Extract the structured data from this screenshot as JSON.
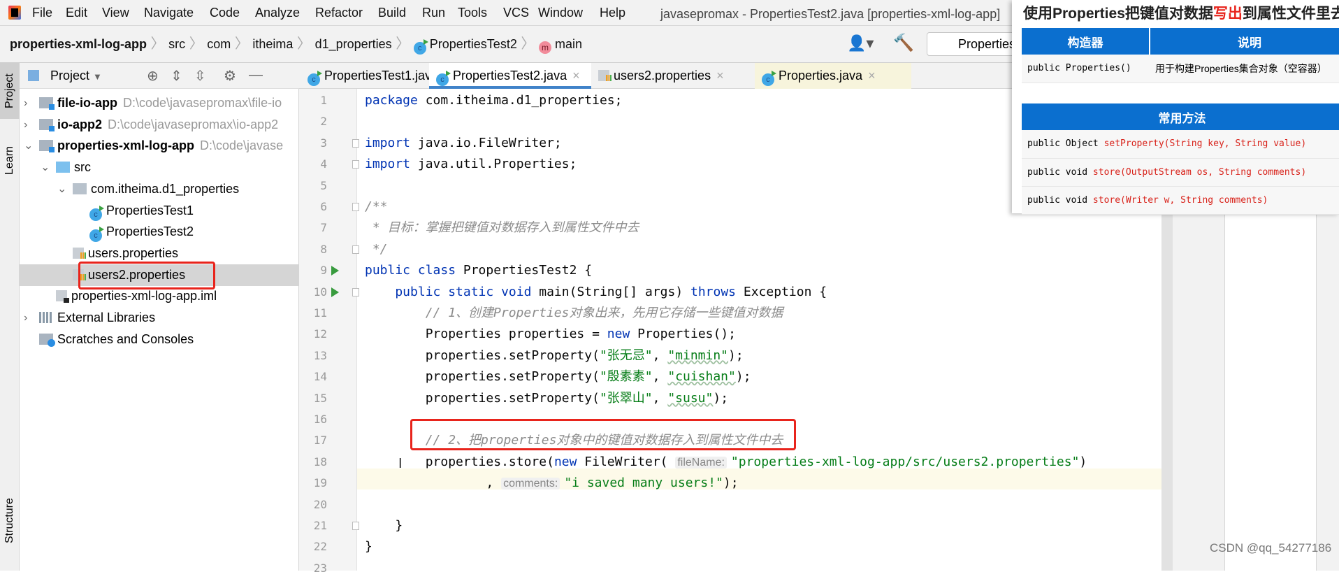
{
  "menu": [
    "File",
    "Edit",
    "View",
    "Navigate",
    "Code",
    "Analyze",
    "Refactor",
    "Build",
    "Run",
    "Tools",
    "VCS",
    "Window",
    "Help"
  ],
  "window_title": "javasepromax - PropertiesTest2.java [properties-xml-log-app]",
  "breadcrumb": [
    "properties-xml-log-app",
    "src",
    "com",
    "itheima",
    "d1_properties",
    "PropertiesTest2",
    "main"
  ],
  "run_config": "Properties",
  "left_stripe": {
    "project": "Project",
    "learn": "Learn",
    "structure": "Structure"
  },
  "project_panel": {
    "title": "Project",
    "tree": [
      {
        "label": "file-io-app",
        "path": "D:\\code\\javasepromax\\file-io",
        "icon": "module",
        "depth": 0,
        "arrow": "›",
        "bold": true
      },
      {
        "label": "io-app2",
        "path": "D:\\code\\javasepromax\\io-app2",
        "icon": "module",
        "depth": 0,
        "arrow": "›",
        "bold": true
      },
      {
        "label": "properties-xml-log-app",
        "path": "D:\\code\\javase",
        "icon": "module",
        "depth": 0,
        "arrow": "⌄",
        "bold": true
      },
      {
        "label": "src",
        "icon": "folder",
        "depth": 1,
        "arrow": "⌄"
      },
      {
        "label": "com.itheima.d1_properties",
        "icon": "package",
        "depth": 2,
        "arrow": "⌄"
      },
      {
        "label": "PropertiesTest1",
        "icon": "class",
        "depth": 3
      },
      {
        "label": "PropertiesTest2",
        "icon": "class",
        "depth": 3
      },
      {
        "label": "users.properties",
        "icon": "properties",
        "depth": 2
      },
      {
        "label": "users2.properties",
        "icon": "properties",
        "depth": 2,
        "selected": true
      },
      {
        "label": "properties-xml-log-app.iml",
        "icon": "iml",
        "depth": 1
      },
      {
        "label": "External Libraries",
        "icon": "library",
        "depth": 0,
        "arrow": "›"
      },
      {
        "label": "Scratches and Consoles",
        "icon": "scratch",
        "depth": 0
      }
    ]
  },
  "tabs": [
    {
      "label": "PropertiesTest1.java",
      "icon": "class"
    },
    {
      "label": "PropertiesTest2.java",
      "icon": "class",
      "active": true
    },
    {
      "label": "users2.properties",
      "icon": "properties"
    },
    {
      "label": "Properties.java",
      "icon": "class-lib",
      "highlighted": true
    }
  ],
  "code": [
    [
      [
        "package",
        "kw"
      ],
      [
        " com.itheima.d1_properties;",
        ""
      ]
    ],
    [],
    [
      [
        "import",
        "kw"
      ],
      [
        " java.io.FileWriter;",
        ""
      ]
    ],
    [
      [
        "import",
        "kw"
      ],
      [
        " java.util.Properties;",
        ""
      ]
    ],
    [],
    [
      [
        "/**",
        "cm"
      ]
    ],
    [
      [
        " * 目标：掌握把键值对数据存入到属性文件中去",
        "cm"
      ]
    ],
    [
      [
        " */",
        "cm"
      ]
    ],
    [
      [
        "public class",
        "kw"
      ],
      [
        " PropertiesTest2 {",
        ""
      ]
    ],
    [
      [
        "    public static void",
        "kw"
      ],
      [
        " main(String[] args) ",
        ""
      ],
      [
        "throws",
        "kw"
      ],
      [
        " Exception {",
        ""
      ]
    ],
    [
      [
        "        // 1、创建Properties对象出来，先用它存储一些键值对数据",
        "cm"
      ]
    ],
    [
      [
        "        Properties properties = ",
        ""
      ],
      [
        "new",
        "kw"
      ],
      [
        " Properties();",
        ""
      ]
    ],
    [
      [
        "        properties.setProperty(",
        ""
      ],
      [
        "\"张无忌\"",
        "str"
      ],
      [
        ", ",
        ""
      ],
      [
        "\"minmin\"",
        "str wavy"
      ],
      [
        ");",
        ""
      ]
    ],
    [
      [
        "        properties.setProperty(",
        ""
      ],
      [
        "\"殷素素\"",
        "str"
      ],
      [
        ", ",
        ""
      ],
      [
        "\"cuishan\"",
        "str wavy"
      ],
      [
        ");",
        ""
      ]
    ],
    [
      [
        "        properties.setProperty(",
        ""
      ],
      [
        "\"张翠山\"",
        "str"
      ],
      [
        ", ",
        ""
      ],
      [
        "\"susu\"",
        "str wavy"
      ],
      [
        ");",
        ""
      ]
    ],
    [],
    [
      [
        "        // 2、把properties对象中的键值对数据存入到属性文件中去",
        "cm"
      ]
    ],
    [
      [
        "        properties.store(",
        ""
      ],
      [
        "new",
        "kw"
      ],
      [
        " FileWriter( ",
        ""
      ],
      [
        "fileName:",
        "hint"
      ],
      [
        "\"properties-xml-log-app/src/users2.properties\"",
        "str"
      ],
      [
        ")",
        ""
      ]
    ],
    [
      [
        "                , ",
        ""
      ],
      [
        "comments:",
        "hint"
      ],
      [
        "\"i saved many users!\"",
        "str"
      ],
      [
        ");",
        ""
      ]
    ],
    [],
    [
      [
        "    }",
        ""
      ]
    ],
    [
      [
        "}",
        ""
      ]
    ],
    []
  ],
  "run_lines": [
    9,
    10
  ],
  "fold_lines": [
    3,
    4,
    6,
    8,
    10,
    21
  ],
  "current_line": 19,
  "reference": {
    "title_pre": "使用Properties把键值对数据",
    "title_hl": "写出",
    "title_post": "到属性文件里去",
    "constructor_table": {
      "headers": [
        "构造器",
        "说明"
      ],
      "rows": [
        [
          "public Properties()",
          "用于构建Properties集合对象（空容器）"
        ]
      ]
    },
    "methods_table": {
      "header": "常用方法",
      "rows": [
        {
          "pre": "public Object ",
          "sig": "setProperty(String key, String value)"
        },
        {
          "pre": "public void ",
          "sig": "store(OutputStream os, String comments)"
        },
        {
          "pre": "public void ",
          "sig": "store(Writer w, String comments)"
        }
      ]
    },
    "highlight_color": "#e8241c",
    "header_color": "#0b6fcf"
  },
  "watermark": "CSDN @qq_54277186"
}
